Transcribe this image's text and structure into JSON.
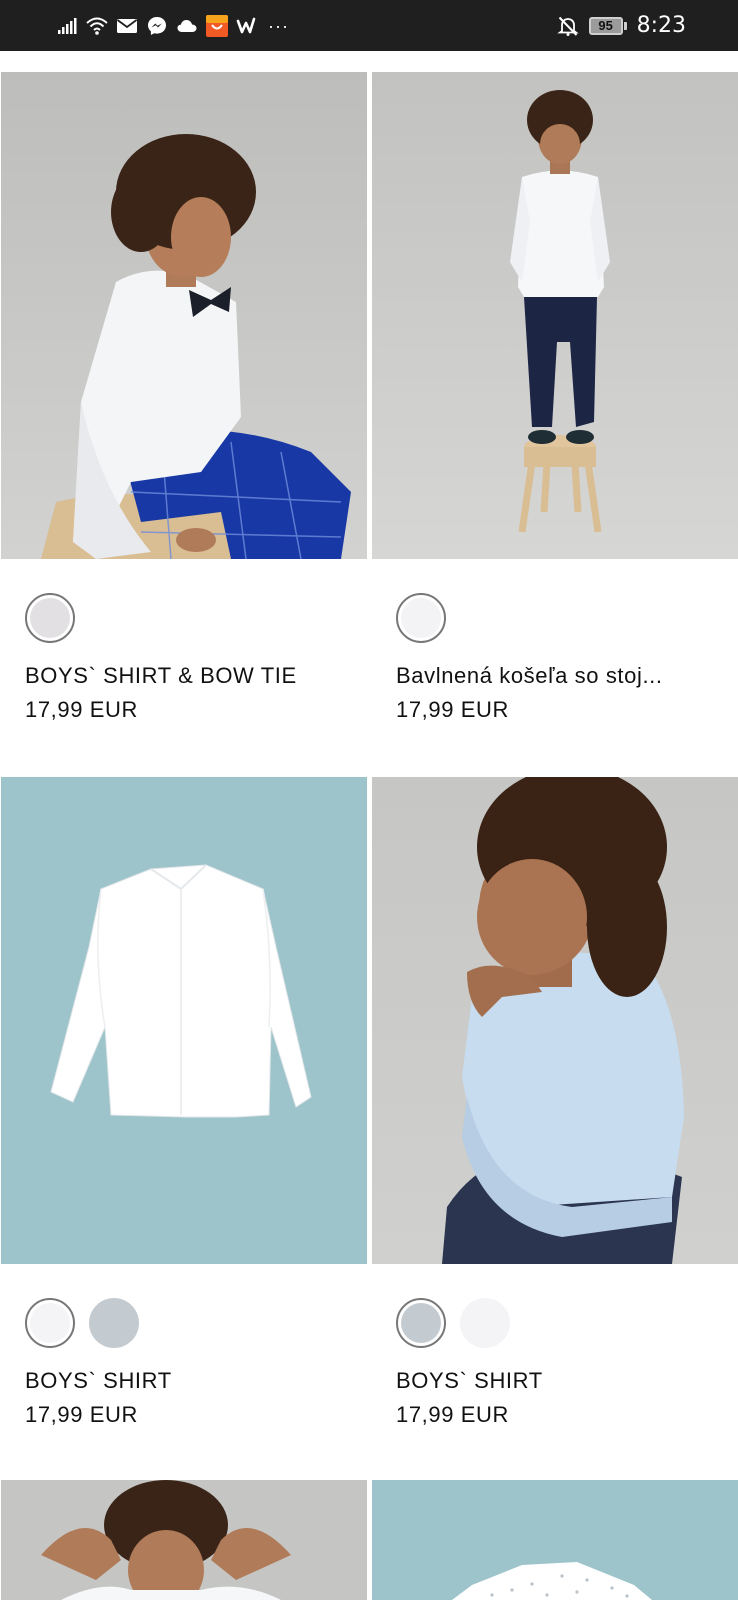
{
  "status_bar": {
    "battery": "95",
    "time": "8:23",
    "left_icons": [
      "signal-icon",
      "wifi-icon",
      "mail-icon",
      "messenger-icon",
      "cloud-icon",
      "shopping-app-icon",
      "wish-app-icon"
    ],
    "more": "···",
    "right_icons": [
      "notifications-off-icon",
      "battery-icon"
    ]
  },
  "products": [
    {
      "name": "BOYS` SHIRT & BOW TIE",
      "price": "17,99 EUR",
      "image": "boy-sitting-white-shirt-bow-tie-blue-check-trousers",
      "background": "#c9c9c7",
      "swatches": [
        {
          "color": "#e3e0e3",
          "selected": true
        }
      ]
    },
    {
      "name": "Bavlnená košeľa so stoj...",
      "price": "17,99 EUR",
      "image": "boy-standing-on-stool-white-shirt-navy-trousers",
      "background": "#cfcfcd",
      "swatches": [
        {
          "color": "#f3f3f6",
          "selected": true
        }
      ]
    },
    {
      "name": "BOYS` SHIRT",
      "price": "17,99 EUR",
      "image": "white-shirt-flat-lay-on-teal-background",
      "background": "#9fc6cd",
      "swatches": [
        {
          "color": "#f4f4f7",
          "selected": true
        },
        {
          "color": "#c3cbd1",
          "selected": false
        }
      ]
    },
    {
      "name": "BOYS` SHIRT",
      "price": "17,99 EUR",
      "image": "boy-chin-on-hand-light-blue-shirt",
      "background": "#cbcbc9",
      "swatches": [
        {
          "color": "#c3cbd1",
          "selected": true
        },
        {
          "color": "#f4f4f7",
          "selected": false
        }
      ]
    },
    {
      "image": "boy-hands-behind-head-white-shirt",
      "background": "#c7c7c5"
    },
    {
      "image": "patterned-white-shirt-on-teal-background",
      "background": "#9fc6cd"
    }
  ]
}
